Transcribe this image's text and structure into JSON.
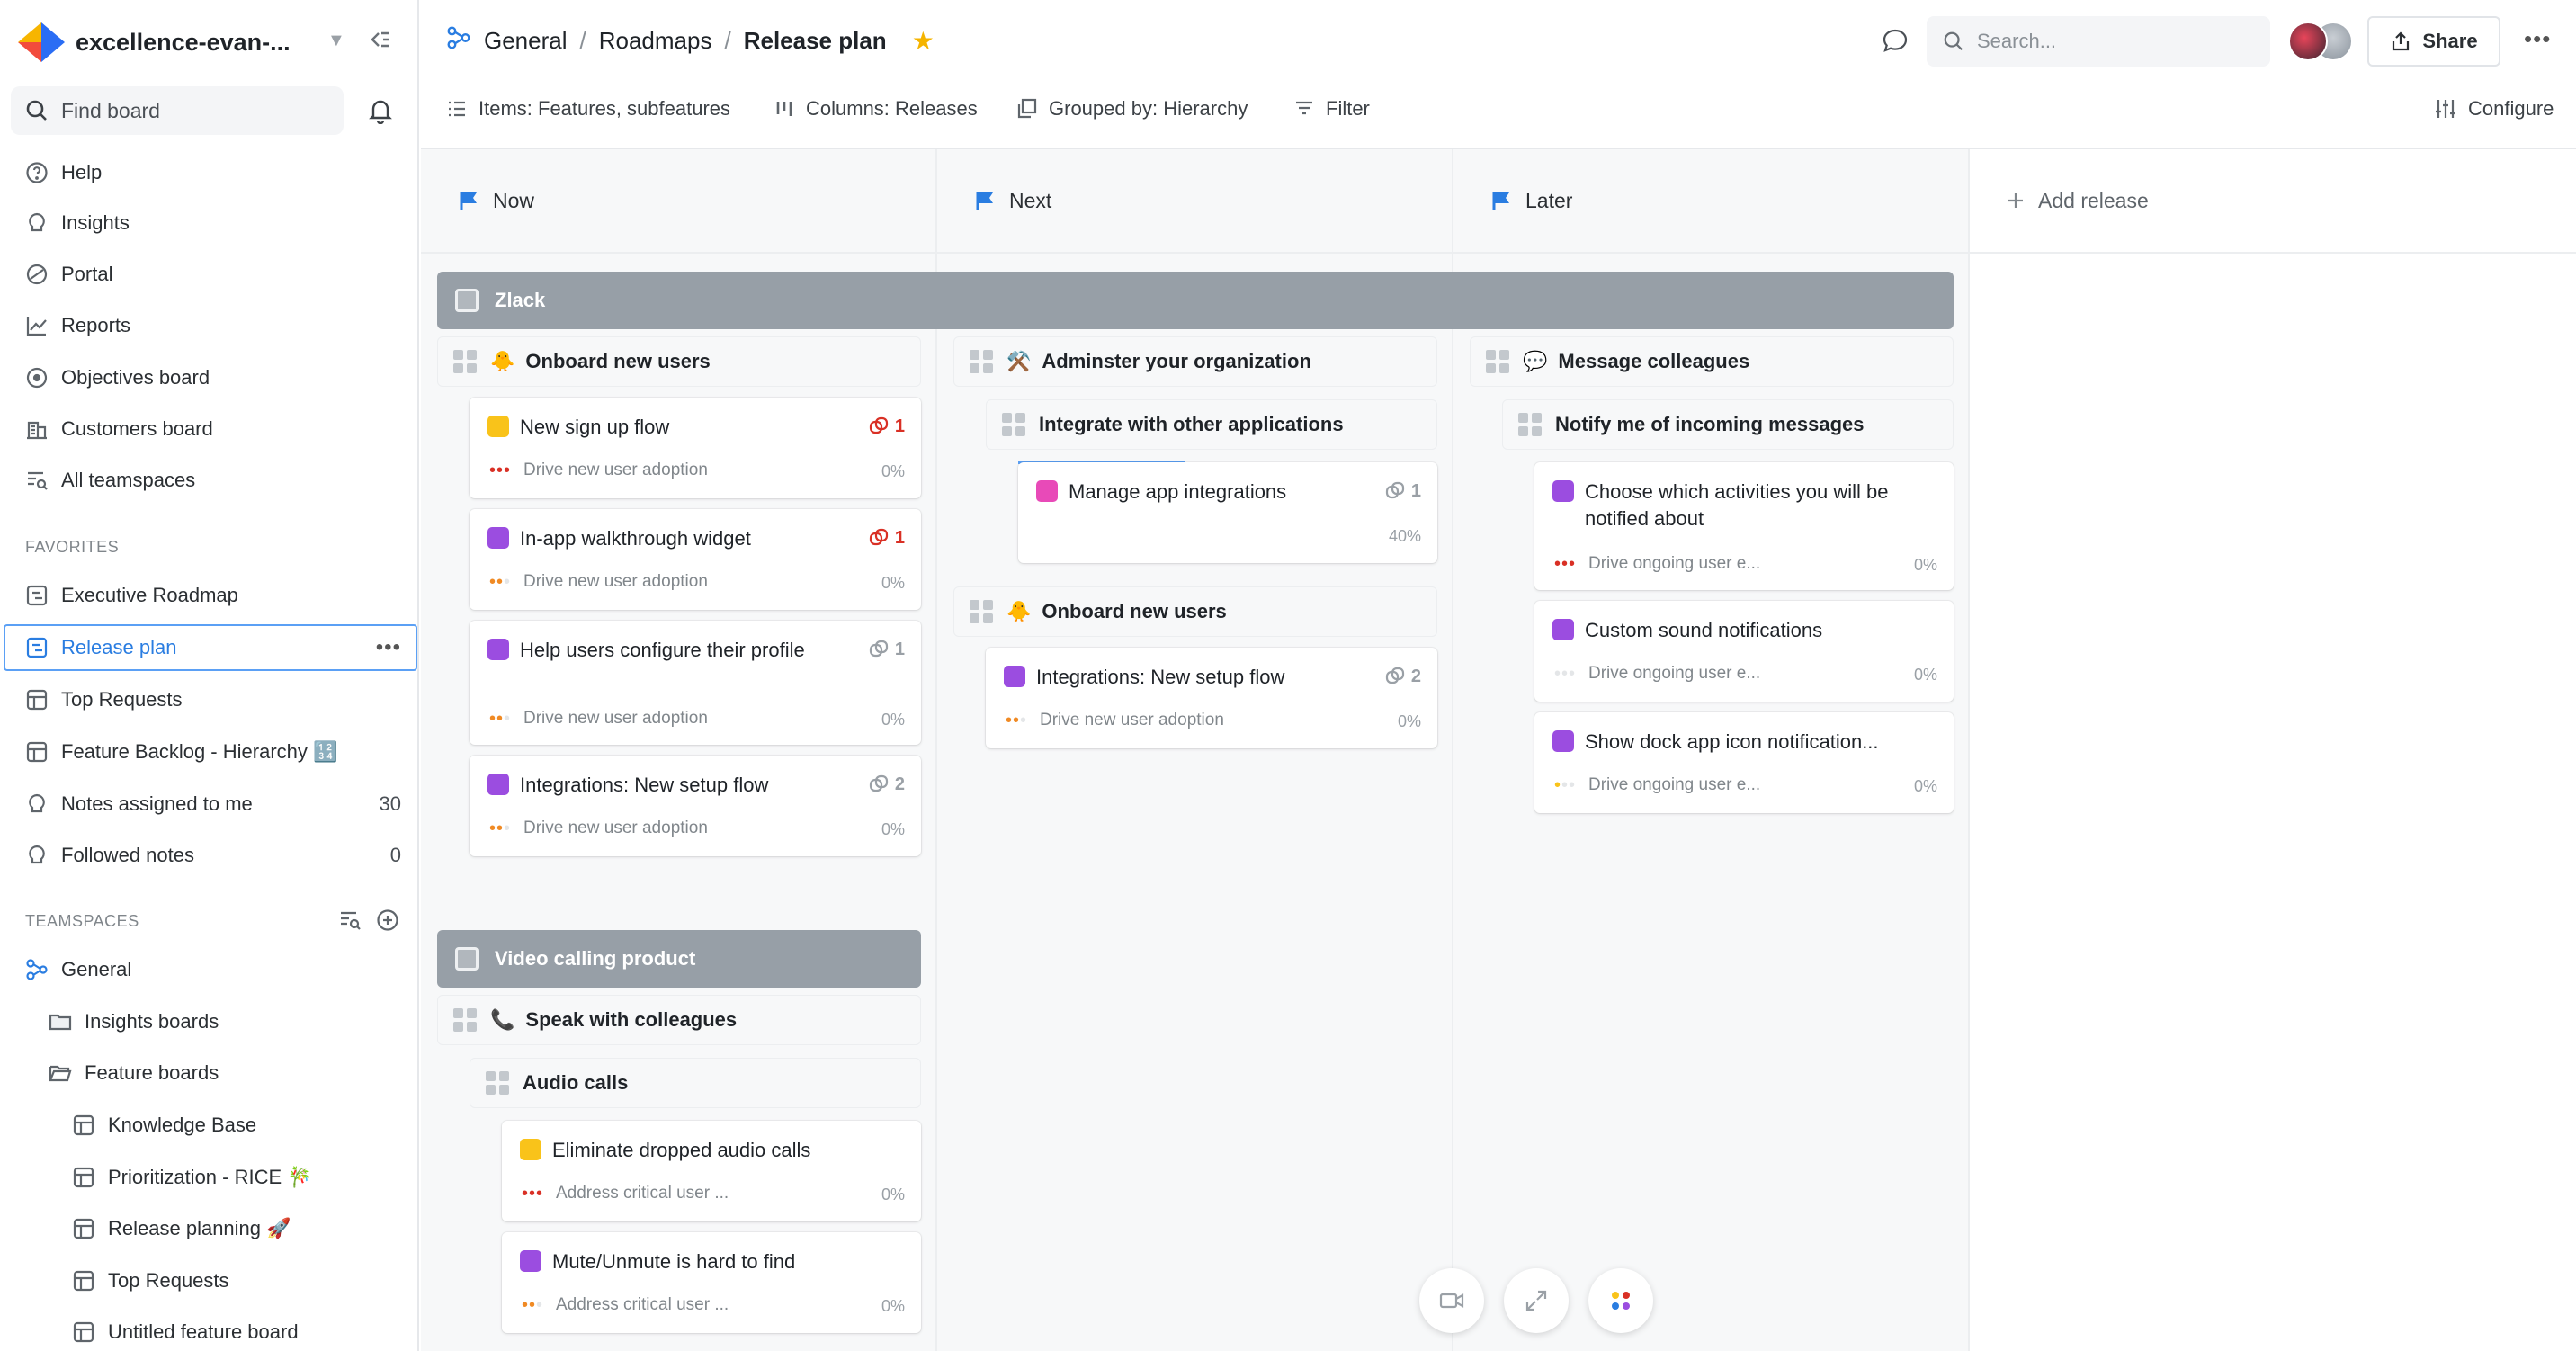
{
  "workspace": {
    "name": "excellence-evan-..."
  },
  "sidebar": {
    "find_placeholder": "Find board",
    "nav": [
      {
        "label": "Help",
        "icon": "help-icon"
      },
      {
        "label": "Insights",
        "icon": "lightbulb-icon"
      },
      {
        "label": "Portal",
        "icon": "portal-icon"
      },
      {
        "label": "Reports",
        "icon": "chart-icon"
      },
      {
        "label": "Objectives board",
        "icon": "target-icon"
      },
      {
        "label": "Customers board",
        "icon": "building-icon"
      },
      {
        "label": "All teamspaces",
        "icon": "list-search-icon"
      }
    ],
    "favorites_label": "FAVORITES",
    "favorites": [
      {
        "label": "Executive Roadmap",
        "icon": "roadmap-icon"
      },
      {
        "label": "Release plan",
        "icon": "roadmap-icon",
        "active": true
      },
      {
        "label": "Top Requests",
        "icon": "table-icon"
      },
      {
        "label": "Feature Backlog - Hierarchy 🔢",
        "icon": "table-icon"
      },
      {
        "label": "Notes assigned to me",
        "icon": "lightbulb-icon",
        "count": "30"
      },
      {
        "label": "Followed notes",
        "icon": "lightbulb-icon",
        "count": "0"
      }
    ],
    "teamspaces_label": "TEAMSPACES",
    "teamspaces": [
      {
        "label": "General",
        "icon": "teamspace-icon"
      },
      {
        "label": "Insights boards",
        "icon": "folder-icon"
      },
      {
        "label": "Feature boards",
        "icon": "folder-open-icon"
      },
      {
        "label": "Knowledge Base",
        "icon": "table-icon"
      },
      {
        "label": "Prioritization - RICE 🎋",
        "icon": "table-icon"
      },
      {
        "label": "Release planning 🚀",
        "icon": "table-icon"
      },
      {
        "label": "Top Requests",
        "icon": "table-icon"
      },
      {
        "label": "Untitled feature board",
        "icon": "table-icon"
      }
    ]
  },
  "header": {
    "breadcrumbs": [
      "General",
      "Roadmaps",
      "Release plan"
    ],
    "search_placeholder": "Search...",
    "share_label": "Share"
  },
  "toolbar": {
    "items": "Items: Features, subfeatures",
    "columns": "Columns: Releases",
    "grouped": "Grouped by: Hierarchy",
    "filter": "Filter",
    "configure": "Configure"
  },
  "columns": [
    {
      "label": "Now",
      "flag_color": "#2a7de1"
    },
    {
      "label": "Next",
      "flag_color": "#2a7de1"
    },
    {
      "label": "Later",
      "flag_color": "#2a7de1"
    }
  ],
  "add_release": "Add release",
  "colors": {
    "yellow": "#f9c31a",
    "purple": "#9b4de0",
    "pink": "#e84ab8",
    "red": "#d93025",
    "orange": "#f08a24",
    "accent": "#2a7de1",
    "group": "#979fa7"
  },
  "groups": [
    {
      "label": "Zlack"
    },
    {
      "label": "Video calling product"
    }
  ],
  "headers": {
    "onboard1": {
      "label": "Onboard new users",
      "emoji": "🐥"
    },
    "admin": {
      "label": "Adminster your organization",
      "emoji": "⚒️"
    },
    "message": {
      "label": "Message colleagues",
      "emoji": "💬"
    },
    "integrate": {
      "label": "Integrate with other applications"
    },
    "notify": {
      "label": "Notify me of incoming messages"
    },
    "onboard2": {
      "label": "Onboard new users",
      "emoji": "🐥"
    },
    "speak": {
      "label": "Speak with colleagues",
      "emoji": "📞"
    },
    "audio": {
      "label": "Audio calls"
    }
  },
  "cards": {
    "c1": {
      "title": "New sign up flow",
      "color": "#f9c31a",
      "links": "1",
      "objective": "Drive new user adoption",
      "pct": "0%"
    },
    "c2": {
      "title": "In-app walkthrough widget",
      "color": "#9b4de0",
      "links": "1",
      "objective": "Drive new user adoption",
      "pct": "0%"
    },
    "c3": {
      "title": "Help users configure their profile",
      "color": "#9b4de0",
      "links": "1",
      "objective": "Drive new user adoption",
      "pct": "0%"
    },
    "c4": {
      "title": "Integrations: New setup flow",
      "color": "#9b4de0",
      "links": "2",
      "objective": "Drive new user adoption",
      "pct": "0%"
    },
    "c5": {
      "title": "Manage app integrations",
      "color": "#e84ab8",
      "links": "1",
      "pct": "40%"
    },
    "c6": {
      "title": "Integrations: New setup flow",
      "color": "#9b4de0",
      "links": "2",
      "objective": "Drive new user adoption",
      "pct": "0%"
    },
    "c7": {
      "title": "Choose which activities you will be notified about",
      "color": "#9b4de0",
      "objective": "Drive ongoing user e...",
      "pct": "0%"
    },
    "c8": {
      "title": "Custom sound notifications",
      "color": "#9b4de0",
      "objective": "Drive ongoing user e...",
      "pct": "0%"
    },
    "c9": {
      "title": "Show dock app icon notification...",
      "color": "#9b4de0",
      "objective": "Drive ongoing user e...",
      "pct": "0%"
    },
    "c10": {
      "title": "Eliminate dropped audio calls",
      "color": "#f9c31a",
      "objective": "Address critical user ...",
      "pct": "0%"
    },
    "c11": {
      "title": "Mute/Unmute is hard to find",
      "color": "#9b4de0",
      "objective": "Address critical user ...",
      "pct": "0%"
    }
  }
}
